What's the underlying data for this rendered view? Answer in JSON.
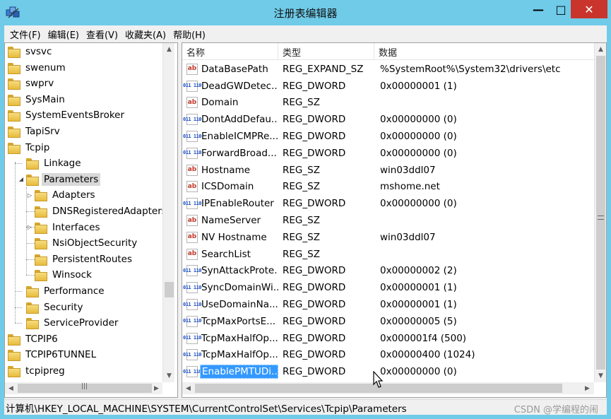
{
  "window": {
    "title": "注册表编辑器",
    "controls": {
      "minimize": "—",
      "maximize": "□",
      "close": "✕"
    }
  },
  "menu": [
    "文件(F)",
    "编辑(E)",
    "查看(V)",
    "收藏夹(A)",
    "帮助(H)"
  ],
  "tree": {
    "items": [
      {
        "label": "svsvc",
        "level": 0
      },
      {
        "label": "swenum",
        "level": 0
      },
      {
        "label": "swprv",
        "level": 0
      },
      {
        "label": "SysMain",
        "level": 0
      },
      {
        "label": "SystemEventsBroker",
        "level": 0
      },
      {
        "label": "TapiSrv",
        "level": 0
      },
      {
        "label": "Tcpip",
        "level": 0
      },
      {
        "label": "Linkage",
        "level": 1
      },
      {
        "label": "Parameters",
        "level": 1,
        "expanded": true,
        "selected": true
      },
      {
        "label": "Adapters",
        "level": 2,
        "expandable": true
      },
      {
        "label": "DNSRegisteredAdapters",
        "level": 2
      },
      {
        "label": "Interfaces",
        "level": 2,
        "expandable": true
      },
      {
        "label": "NsiObjectSecurity",
        "level": 2
      },
      {
        "label": "PersistentRoutes",
        "level": 2
      },
      {
        "label": "Winsock",
        "level": 2
      },
      {
        "label": "Performance",
        "level": 1
      },
      {
        "label": "Security",
        "level": 1
      },
      {
        "label": "ServiceProvider",
        "level": 1
      },
      {
        "label": "TCPIP6",
        "level": 0
      },
      {
        "label": "TCPIP6TUNNEL",
        "level": 0
      },
      {
        "label": "tcpipreg",
        "level": 0
      }
    ]
  },
  "list": {
    "headers": {
      "name": "名称",
      "type": "类型",
      "data": "数据"
    },
    "rows": [
      {
        "icon": "string-value-icon",
        "name": "DataBasePath",
        "type": "REG_EXPAND_SZ",
        "data": "%SystemRoot%\\System32\\drivers\\etc"
      },
      {
        "icon": "binary-value-icon",
        "name": "DeadGWDetec...",
        "type": "REG_DWORD",
        "data": "0x00000001 (1)"
      },
      {
        "icon": "string-value-icon",
        "name": "Domain",
        "type": "REG_SZ",
        "data": ""
      },
      {
        "icon": "binary-value-icon",
        "name": "DontAddDefau...",
        "type": "REG_DWORD",
        "data": "0x00000000 (0)"
      },
      {
        "icon": "binary-value-icon",
        "name": "EnableICMPRe...",
        "type": "REG_DWORD",
        "data": "0x00000000 (0)"
      },
      {
        "icon": "binary-value-icon",
        "name": "ForwardBroad...",
        "type": "REG_DWORD",
        "data": "0x00000000 (0)"
      },
      {
        "icon": "string-value-icon",
        "name": "Hostname",
        "type": "REG_SZ",
        "data": "win03ddl07"
      },
      {
        "icon": "string-value-icon",
        "name": "ICSDomain",
        "type": "REG_SZ",
        "data": "mshome.net"
      },
      {
        "icon": "binary-value-icon",
        "name": "IPEnableRouter",
        "type": "REG_DWORD",
        "data": "0x00000000 (0)"
      },
      {
        "icon": "string-value-icon",
        "name": "NameServer",
        "type": "REG_SZ",
        "data": ""
      },
      {
        "icon": "string-value-icon",
        "name": "NV Hostname",
        "type": "REG_SZ",
        "data": "win03ddl07"
      },
      {
        "icon": "string-value-icon",
        "name": "SearchList",
        "type": "REG_SZ",
        "data": ""
      },
      {
        "icon": "binary-value-icon",
        "name": "SynAttackProte...",
        "type": "REG_DWORD",
        "data": "0x00000002 (2)"
      },
      {
        "icon": "binary-value-icon",
        "name": "SyncDomainWi...",
        "type": "REG_DWORD",
        "data": "0x00000001 (1)"
      },
      {
        "icon": "binary-value-icon",
        "name": "UseDomainNa...",
        "type": "REG_DWORD",
        "data": "0x00000001 (1)"
      },
      {
        "icon": "binary-value-icon",
        "name": "TcpMaxPortsE...",
        "type": "REG_DWORD",
        "data": "0x00000005 (5)"
      },
      {
        "icon": "binary-value-icon",
        "name": "TcpMaxHalfOp...",
        "type": "REG_DWORD",
        "data": "0x000001f4 (500)"
      },
      {
        "icon": "binary-value-icon",
        "name": "TcpMaxHalfOp...",
        "type": "REG_DWORD",
        "data": "0x00000400 (1024)"
      },
      {
        "icon": "binary-value-icon",
        "name": "EnablePMTUDi...",
        "type": "REG_DWORD",
        "data": "0x00000000 (0)",
        "selected": true
      }
    ]
  },
  "icons": {
    "string_glyph": "ab",
    "binary_glyph": "011 110",
    "expand_glyph": "▷",
    "expanded_glyph": "◢",
    "scroll_up": "▲",
    "scroll_down": "▼",
    "scroll_left": "◀",
    "scroll_right": "▶",
    "grip": "|||"
  },
  "status": {
    "path": "计算机\\HKEY_LOCAL_MACHINE\\SYSTEM\\CurrentControlSet\\Services\\Tcpip\\Parameters",
    "watermark": "CSDN @学编程的闹"
  },
  "colors": {
    "title_bg": "#6fcbe8",
    "close_bg": "#c9352c",
    "selection": "#3399ff",
    "tree_selection": "#d9d9d9"
  }
}
